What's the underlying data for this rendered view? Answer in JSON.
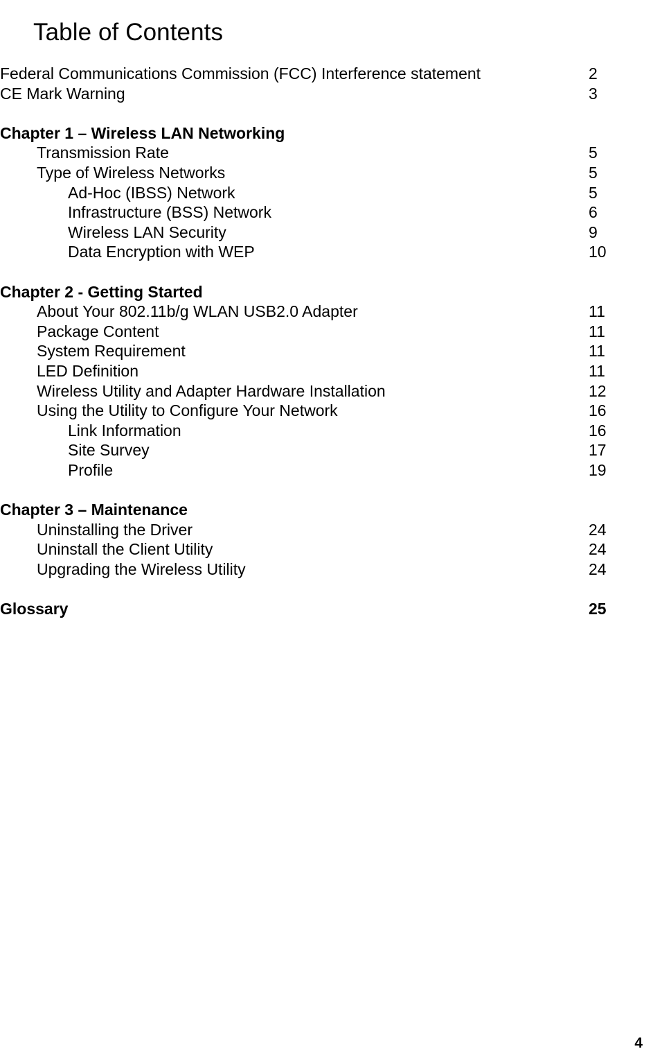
{
  "document": {
    "title": "Table of Contents",
    "footer_page_number": "4"
  },
  "toc": {
    "entries": [
      {
        "label": "Federal Communications Commission (FCC) Interference statement",
        "page": "2",
        "level": 0,
        "bold": false,
        "spacer_before": false
      },
      {
        "label": "CE Mark Warning",
        "page": "3",
        "level": 0,
        "bold": false,
        "spacer_before": false
      },
      {
        "label": "Chapter 1 – Wireless LAN Networking",
        "page": "",
        "level": 0,
        "bold": true,
        "spacer_before": true
      },
      {
        "label": "Transmission Rate",
        "page": "5",
        "level": 1,
        "bold": false,
        "spacer_before": false
      },
      {
        "label": "Type of Wireless Networks",
        "page": "5",
        "level": 1,
        "bold": false,
        "spacer_before": false
      },
      {
        "label": "Ad-Hoc (IBSS) Network",
        "page": "5",
        "level": 2,
        "bold": false,
        "spacer_before": false
      },
      {
        "label": "Infrastructure (BSS) Network",
        "page": "6",
        "level": 2,
        "bold": false,
        "spacer_before": false
      },
      {
        "label": "Wireless LAN Security",
        "page": "9",
        "level": 2,
        "bold": false,
        "spacer_before": false
      },
      {
        "label": "Data Encryption with WEP",
        "page": "10",
        "level": 2,
        "bold": false,
        "spacer_before": false
      },
      {
        "label": "Chapter 2 - Getting Started",
        "page": "",
        "level": 0,
        "bold": true,
        "spacer_before": true
      },
      {
        "label": "About Your 802.11b/g WLAN USB2.0 Adapter",
        "page": "11",
        "level": 1,
        "bold": false,
        "spacer_before": false
      },
      {
        "label": "Package Content",
        "page": "11",
        "level": 1,
        "bold": false,
        "spacer_before": false
      },
      {
        "label": "System Requirement",
        "page": "11",
        "level": 1,
        "bold": false,
        "spacer_before": false
      },
      {
        "label": "LED Definition",
        "page": "11",
        "level": 1,
        "bold": false,
        "spacer_before": false
      },
      {
        "label": "Wireless Utility and Adapter Hardware Installation",
        "page": "12",
        "level": 1,
        "bold": false,
        "spacer_before": false
      },
      {
        "label": "Using the Utility to Configure Your Network",
        "page": "16",
        "level": 1,
        "bold": false,
        "spacer_before": false
      },
      {
        "label": "Link Information",
        "page": "16",
        "level": 2,
        "bold": false,
        "spacer_before": false
      },
      {
        "label": "Site Survey",
        "page": "17",
        "level": 2,
        "bold": false,
        "spacer_before": false
      },
      {
        "label": "Profile",
        "page": "19",
        "level": 2,
        "bold": false,
        "spacer_before": false
      },
      {
        "label": "Chapter 3 – Maintenance",
        "page": "",
        "level": 0,
        "bold": true,
        "spacer_before": true
      },
      {
        "label": "Uninstalling the Driver",
        "page": "24",
        "level": 1,
        "bold": false,
        "spacer_before": false
      },
      {
        "label": "Uninstall the Client Utility",
        "page": "24",
        "level": 1,
        "bold": false,
        "spacer_before": false
      },
      {
        "label": "Upgrading the Wireless Utility",
        "page": "24",
        "level": 1,
        "bold": false,
        "spacer_before": false
      },
      {
        "label": "Glossary",
        "page": "25",
        "level": 0,
        "bold": true,
        "spacer_before": true
      }
    ]
  }
}
